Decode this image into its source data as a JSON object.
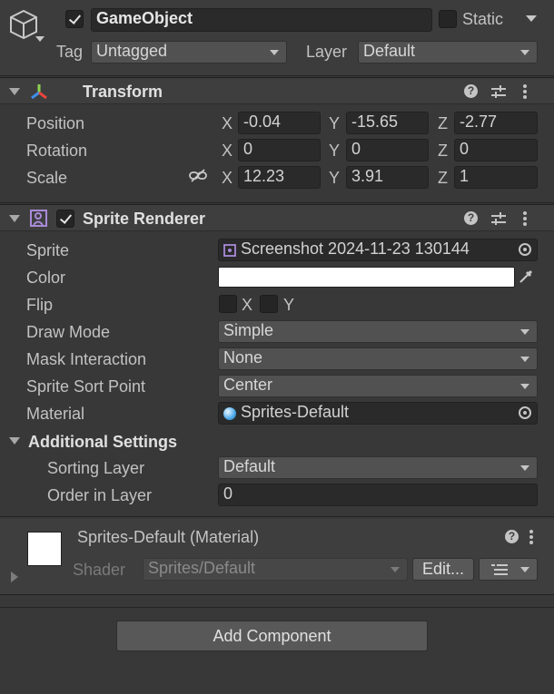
{
  "header": {
    "object_enabled": true,
    "object_name": "GameObject",
    "static_label": "Static",
    "static_checked": false,
    "tag_label": "Tag",
    "tag_value": "Untagged",
    "layer_label": "Layer",
    "layer_value": "Default"
  },
  "transform": {
    "title": "Transform",
    "rows": [
      {
        "label": "Position",
        "x": "-0.04",
        "y": "-15.65",
        "z": "-2.77"
      },
      {
        "label": "Rotation",
        "x": "0",
        "y": "0",
        "z": "0"
      },
      {
        "label": "Scale",
        "x": "12.23",
        "y": "3.91",
        "z": "1"
      }
    ],
    "axis_x": "X",
    "axis_y": "Y",
    "axis_z": "Z"
  },
  "sprite_renderer": {
    "title": "Sprite Renderer",
    "enabled": true,
    "sprite_label": "Sprite",
    "sprite_value": "Screenshot 2024-11-23 130144",
    "color_label": "Color",
    "color_value": "#FFFFFF",
    "flip_label": "Flip",
    "flip_x_label": "X",
    "flip_y_label": "Y",
    "draw_mode_label": "Draw Mode",
    "draw_mode_value": "Simple",
    "mask_label": "Mask Interaction",
    "mask_value": "None",
    "sort_point_label": "Sprite Sort Point",
    "sort_point_value": "Center",
    "material_label": "Material",
    "material_value": "Sprites-Default",
    "additional_title": "Additional Settings",
    "sorting_layer_label": "Sorting Layer",
    "sorting_layer_value": "Default",
    "order_label": "Order in Layer",
    "order_value": "0"
  },
  "material": {
    "title": "Sprites-Default (Material)",
    "shader_label": "Shader",
    "shader_value": "Sprites/Default",
    "edit_label": "Edit..."
  },
  "footer": {
    "add_component_label": "Add Component"
  }
}
